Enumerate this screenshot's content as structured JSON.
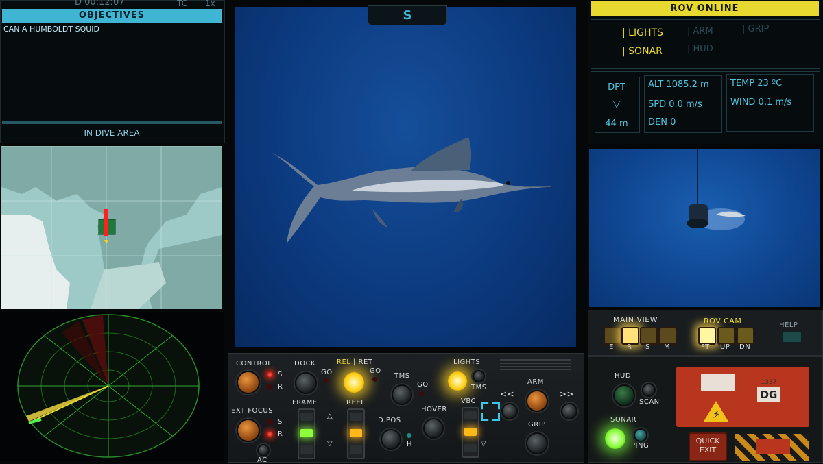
{
  "top_left": {
    "dive_time": "D 00:12:07",
    "tc": "TC",
    "speed": "1x"
  },
  "objectives": {
    "title": "OBJECTIVES",
    "item": "CAN A HUMBOLDT SQUID",
    "status": "IN DIVE AREA"
  },
  "compass": {
    "heading": "S"
  },
  "rov": {
    "status": "ROV ONLINE",
    "modes": [
      {
        "label": "| LIGHTS",
        "active": true
      },
      {
        "label": "| ARM",
        "active": false
      },
      {
        "label": "| GRIP",
        "active": false
      },
      {
        "label": "| SONAR",
        "active": true
      },
      {
        "label": "| HUD",
        "active": false
      }
    ],
    "dpt_label": "DPT",
    "dpt_arrow": "▽",
    "dpt_value": "44 m",
    "alt": "ALT 1085.2 m",
    "spd": "SPD 0.0 m/s",
    "den": "DEN  0",
    "temp": "TEMP 23 ºC",
    "wind": "WIND 0.1 m/s"
  },
  "main_view": {
    "title": "MAIN VIEW",
    "buttons": [
      "E",
      "R",
      "S",
      "M"
    ]
  },
  "rov_cam": {
    "title": "ROV CAM",
    "buttons": [
      "FT",
      "UP",
      "DN"
    ]
  },
  "help_label": "HELP",
  "console": {
    "control": "CONTROL",
    "ext_focus": "EXT FOCUS",
    "s": "S",
    "r": "R",
    "ac": "AC",
    "dock": "DOCK",
    "go": "GO",
    "rel": "REL",
    "ret": "| RET",
    "tms": "TMS",
    "lights": "LIGHTS",
    "frame": "FRAME",
    "reel": "REEL",
    "vbc": "VBC",
    "dpos": "D.POS",
    "h": "H",
    "hover": "HOVER",
    "arm": "ARM",
    "grip": "GRIP",
    "rewind": "<<",
    "forward": ">>"
  },
  "right_console": {
    "hud": "HUD",
    "scan": "SCAN",
    "sonar": "SONAR",
    "ping": "PING",
    "quick_exit": "QUICK EXIT",
    "counter": "1337",
    "code": "DG"
  },
  "colors": {
    "accent_cyan": "#3fb6d4",
    "rov_yellow": "#e8d930",
    "ocean_blue": "#0d3f86"
  }
}
